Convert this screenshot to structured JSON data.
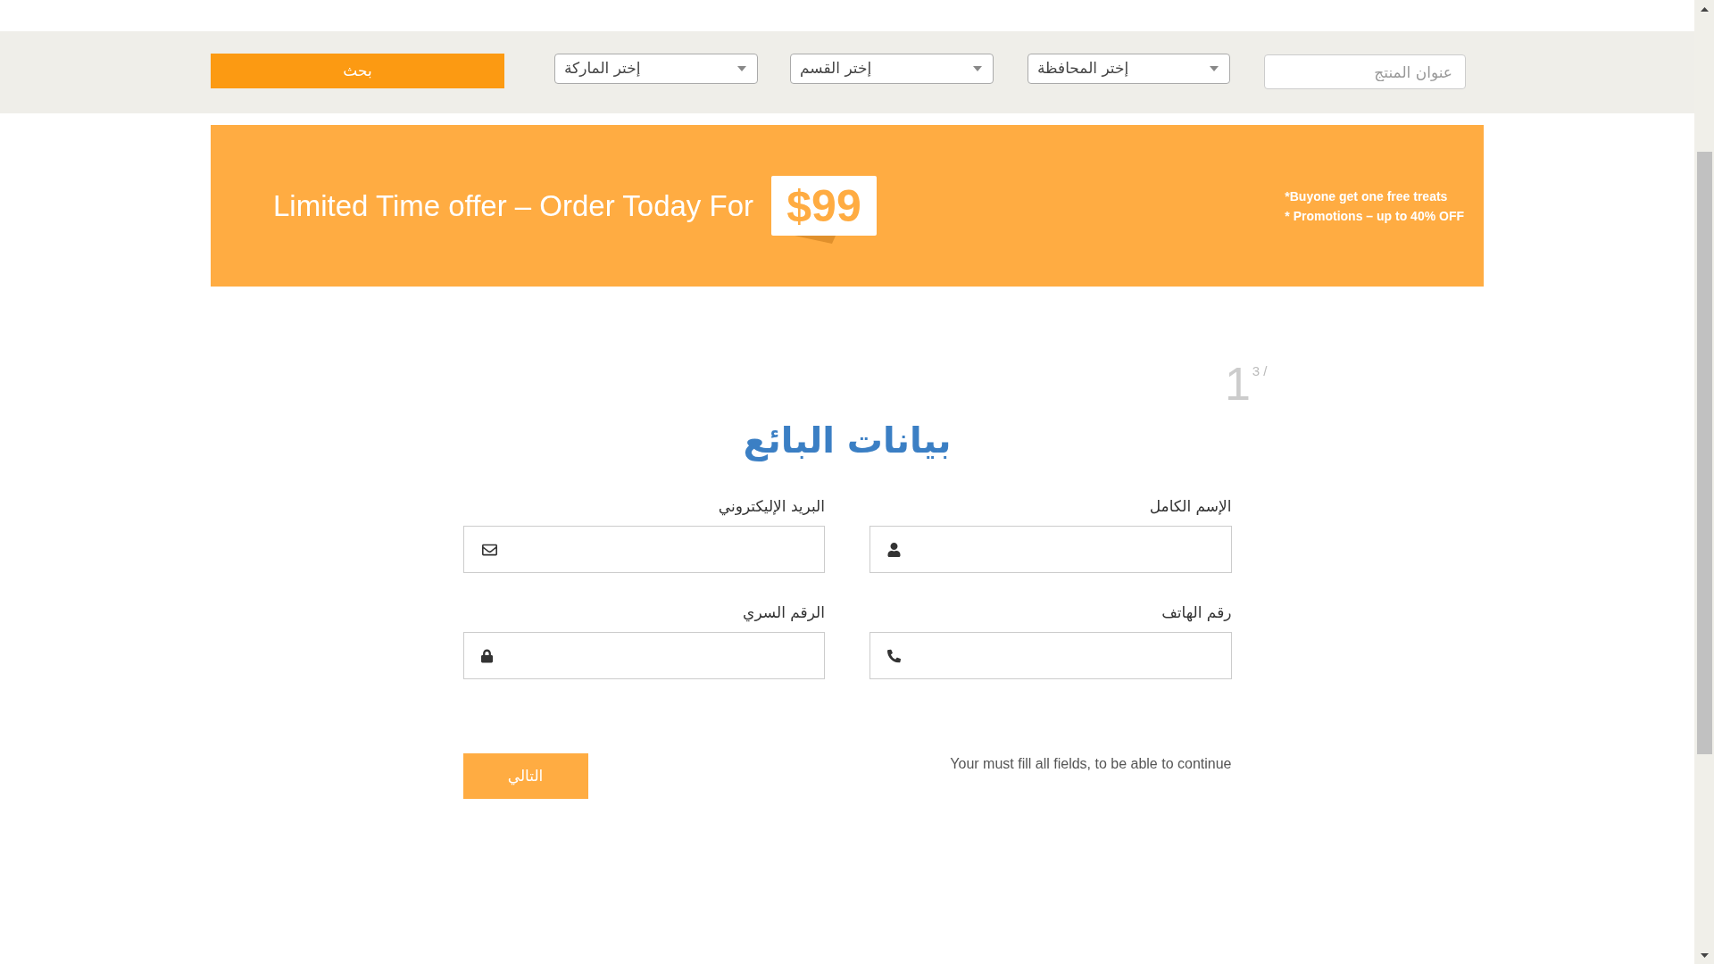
{
  "search_bar": {
    "product_title": {
      "placeholder": "عنوان المنتج"
    },
    "filters": [
      {
        "label": "إختر المحافظة"
      },
      {
        "label": "إختر القسم"
      },
      {
        "label": "إختر الماركة"
      }
    ],
    "search_button": "بحث"
  },
  "banner": {
    "headline": "Limited Time offer – Order Today For",
    "price": "$99",
    "notes": [
      "*Buyone get one free treats",
      "* Promotions – up to 40% OFF"
    ]
  },
  "step": {
    "current": "1",
    "total": "3 /"
  },
  "form": {
    "title": "بيانات البائع",
    "fields": [
      {
        "label": "الإسم الكامل",
        "kind": "name"
      },
      {
        "label": "البريد الإليكتروني",
        "kind": "email"
      },
      {
        "label": "رقم الهاتف",
        "kind": "phone"
      },
      {
        "label": "الرقم السري",
        "kind": "password"
      }
    ],
    "message": "Your must fill all fields, to be able to continue",
    "next_button": "التالي"
  }
}
